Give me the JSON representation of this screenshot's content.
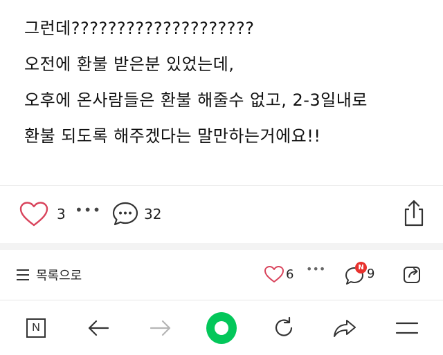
{
  "post": {
    "lines": [
      "그런데????????????????????",
      "오전에 환불 받은분 있었는데,",
      "오후에 온사람들은 환불 해줄수 없고, 2-3일내로",
      "환불 되도록 해주겠다는 말만하는거에요!!"
    ]
  },
  "reactions": {
    "like_count": "3",
    "more": "•••",
    "comment_count": "32"
  },
  "list_bar": {
    "list_label": "목록으로",
    "like_count": "6",
    "more": "•••",
    "comment_badge": "N",
    "comment_count": "9"
  },
  "browser": {
    "n_label": "N"
  },
  "colors": {
    "heart": "#d9445c",
    "badge": "#e8322e",
    "home": "#03c75a"
  }
}
